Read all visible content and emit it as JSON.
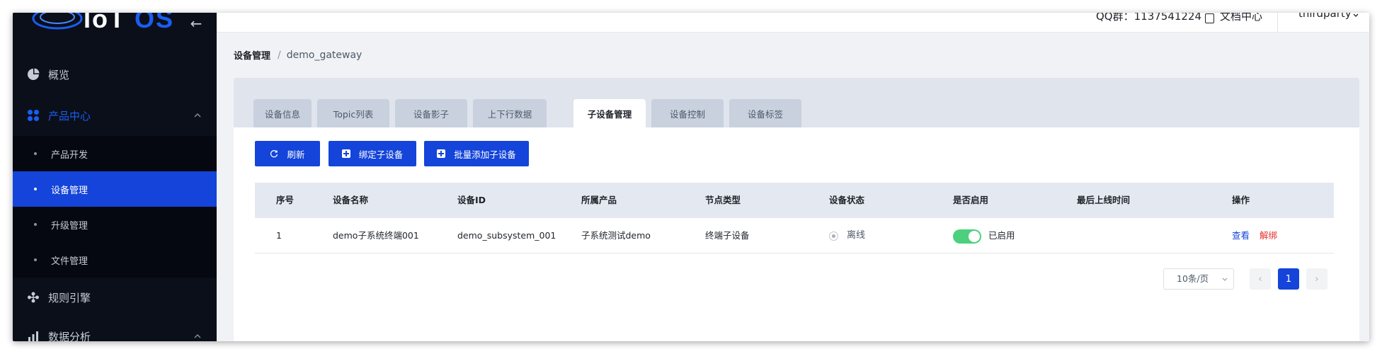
{
  "app": {
    "logo_text": "IoT OS",
    "logo_main": "IoT",
    "logo_accent": "OS",
    "collapse_glyph": "←"
  },
  "header": {
    "qq": "QQ群：1137541224",
    "docs": "文档中心",
    "user": "thirdparty"
  },
  "sidebar": {
    "items": [
      {
        "label": "概览",
        "icon": "pie-chart-icon"
      },
      {
        "label": "产品中心",
        "icon": "apps-icon",
        "expanded": true
      },
      {
        "label": "产品开发"
      },
      {
        "label": "设备管理",
        "selected": true
      },
      {
        "label": "升级管理"
      },
      {
        "label": "文件管理"
      },
      {
        "label": "规则引擎",
        "icon": "rule-icon"
      },
      {
        "label": "数据分析",
        "icon": "chart-icon"
      }
    ]
  },
  "breadcrumb": {
    "root": "设备管理",
    "separator": "/",
    "current": "demo_gateway"
  },
  "tabs": [
    {
      "label": "设备信息"
    },
    {
      "label": "Topic列表"
    },
    {
      "label": "设备影子"
    },
    {
      "label": "上下行数据"
    },
    {
      "label": "子设备管理",
      "active": true
    },
    {
      "label": "设备控制"
    },
    {
      "label": "设备标签"
    }
  ],
  "toolbar": {
    "refresh": "刷新",
    "bind_child": "绑定子设备",
    "batch_add": "批量添加子设备"
  },
  "table": {
    "columns": [
      "序号",
      "设备名称",
      "设备ID",
      "所属产品",
      "节点类型",
      "设备状态",
      "是否启用",
      "最后上线时间",
      "操作"
    ],
    "rows": [
      {
        "index": "1",
        "name": "demo子系统终端001",
        "device_id": "demo_subsystem_001",
        "product": "子系统测试demo",
        "node_type": "终端子设备",
        "status": "离线",
        "enabled": "已启用",
        "last_online": "",
        "view": "查看",
        "unbind": "解绑"
      }
    ]
  },
  "pagination": {
    "page_size": "10条/页",
    "current_page": "1",
    "prev": "‹",
    "next": "›"
  },
  "colors": {
    "primary": "#1444d9",
    "sidebar_bg": "#0a0f1a",
    "toggle_on": "#4cd07d",
    "danger": "#e5322d"
  }
}
